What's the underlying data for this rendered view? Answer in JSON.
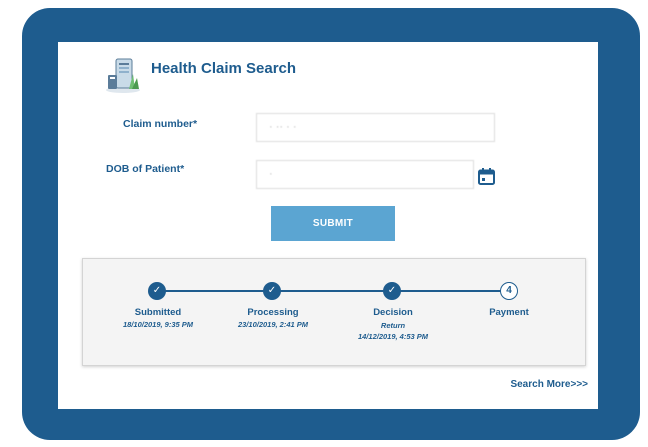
{
  "page": {
    "title": "Health Claim Search"
  },
  "form": {
    "claim_label": "Claim number*",
    "claim_value": "· ·· ·  ·",
    "dob_label": "DOB of Patient*",
    "dob_value": "·",
    "submit_label": "SUBMIT"
  },
  "tracker": {
    "steps": [
      {
        "name": "Submitted",
        "date": "18/10/2019, 9:35 PM",
        "note": "",
        "status": "done",
        "marker": "✓"
      },
      {
        "name": "Processing",
        "date": "23/10/2019, 2:41 PM",
        "note": "",
        "status": "done",
        "marker": "✓"
      },
      {
        "name": "Decision",
        "note": "Return",
        "date": "14/12/2019, 4:53 PM",
        "status": "done",
        "marker": "✓"
      },
      {
        "name": "Payment",
        "date": "",
        "note": "",
        "status": "pending",
        "marker": "4"
      }
    ]
  },
  "footer": {
    "search_more": "Search More>>>"
  },
  "colors": {
    "frame": "#1e5c8e",
    "accent": "#1e5c8e",
    "button": "#5ba5d2",
    "tracker_bg": "#f4f4f4"
  },
  "icons": {
    "logo": "health-claim-illustration-icon",
    "date_picker": "calendar-icon",
    "step_done": "check-icon"
  }
}
